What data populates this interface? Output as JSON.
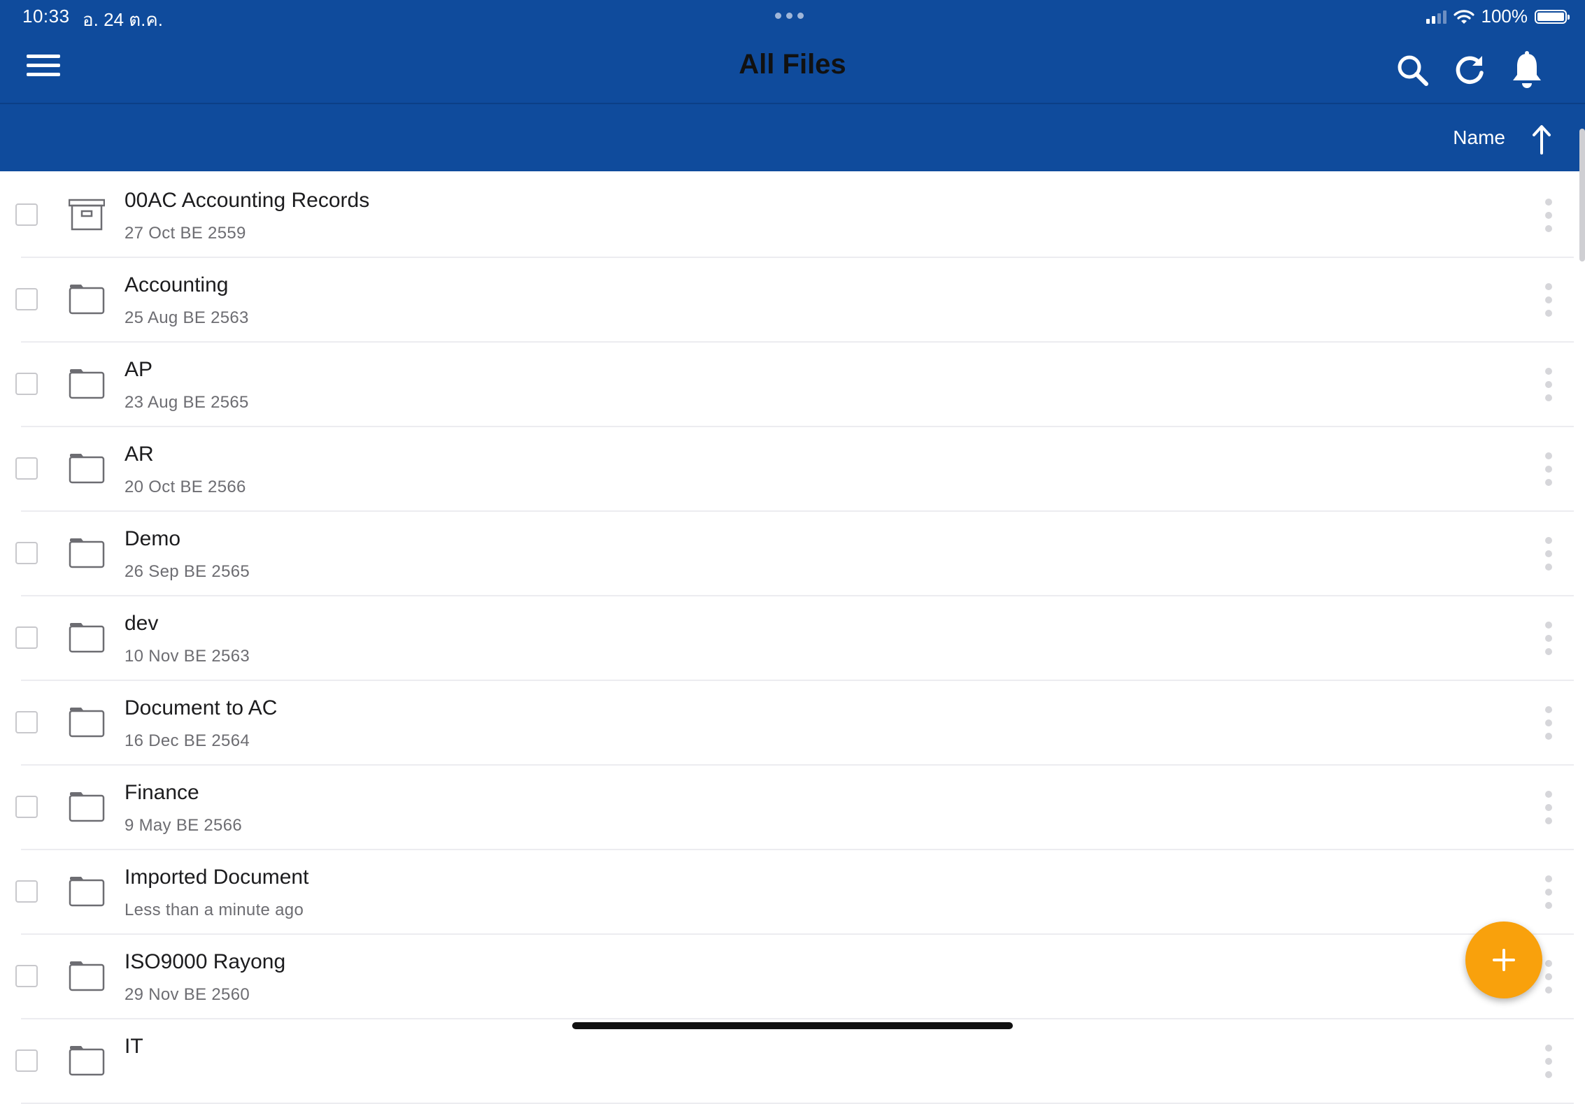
{
  "status_bar": {
    "time": "10:33",
    "date": "อ. 24 ต.ค.",
    "battery_percent": "100%",
    "battery_level": 1.0,
    "signal_bars": 2,
    "signal_total": 4
  },
  "header": {
    "title": "All Files",
    "menu_icon": "hamburger-icon",
    "actions": [
      {
        "name": "search",
        "icon": "search-icon"
      },
      {
        "name": "refresh",
        "icon": "refresh-icon"
      },
      {
        "name": "notifications",
        "icon": "bell-icon"
      }
    ]
  },
  "sort": {
    "label": "Name",
    "direction": "ascending",
    "icon": "arrow-up-icon"
  },
  "items": [
    {
      "name": "00AC Accounting Records",
      "date": "27 Oct BE 2559",
      "icon": "archive-box-icon"
    },
    {
      "name": "Accounting",
      "date": "25 Aug BE 2563",
      "icon": "folder-icon"
    },
    {
      "name": "AP",
      "date": "23 Aug BE 2565",
      "icon": "folder-icon"
    },
    {
      "name": "AR",
      "date": "20 Oct BE 2566",
      "icon": "folder-icon"
    },
    {
      "name": "Demo",
      "date": "26 Sep BE 2565",
      "icon": "folder-icon"
    },
    {
      "name": "dev",
      "date": "10 Nov BE 2563",
      "icon": "folder-icon"
    },
    {
      "name": "Document to AC",
      "date": "16 Dec BE 2564",
      "icon": "folder-icon"
    },
    {
      "name": "Finance",
      "date": "9 May BE 2566",
      "icon": "folder-icon"
    },
    {
      "name": "Imported Document",
      "date": "Less than a minute ago",
      "icon": "folder-icon"
    },
    {
      "name": "ISO9000 Rayong",
      "date": "29 Nov BE 2560",
      "icon": "folder-icon"
    },
    {
      "name": "IT",
      "date": "",
      "icon": "folder-icon"
    }
  ],
  "fab": {
    "icon": "plus-icon"
  },
  "colors": {
    "header_bg": "#0f4b9c",
    "fab": "#f9a10c",
    "icon_gray": "#6d6d72"
  }
}
